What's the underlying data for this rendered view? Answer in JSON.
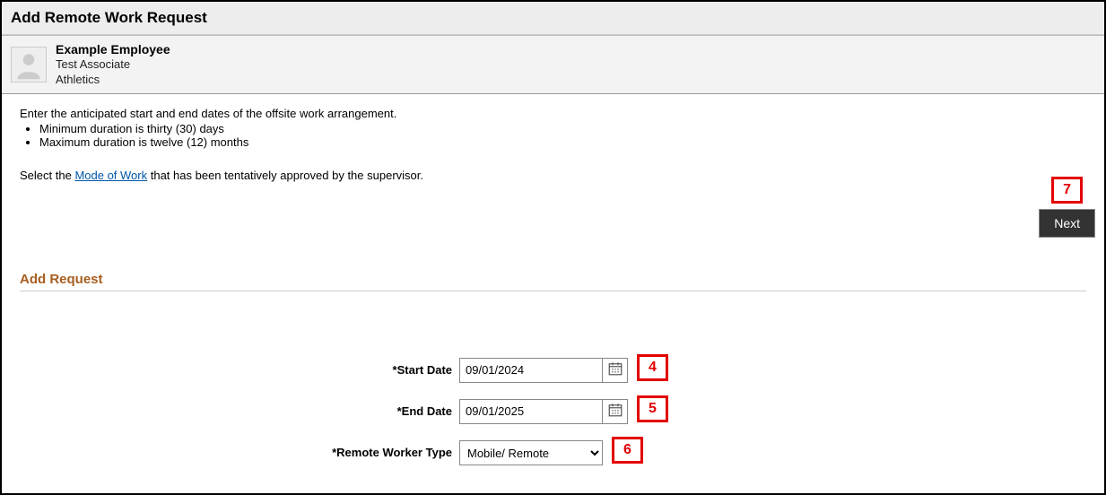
{
  "header": {
    "title": "Add Remote Work Request"
  },
  "employee": {
    "name": "Example Employee",
    "role": "Test Associate",
    "department": "Athletics"
  },
  "instructions": {
    "intro": "Enter the anticipated start and end dates of the offsite work arrangement.",
    "bullets": [
      "Minimum duration is thirty (30) days",
      "Maximum duration is twelve (12) months"
    ],
    "mode_prefix": "Select the ",
    "mode_link": "Mode of Work",
    "mode_suffix": " that has been tentatively approved by the supervisor."
  },
  "next_button": {
    "label": "Next",
    "callout": "7"
  },
  "section": {
    "title": "Add Request"
  },
  "form": {
    "start_date": {
      "label": "*Start Date",
      "value": "09/01/2024",
      "callout": "4"
    },
    "end_date": {
      "label": "*End Date",
      "value": "09/01/2025",
      "callout": "5"
    },
    "worker_type": {
      "label": "*Remote Worker Type",
      "selected": "Mobile/ Remote",
      "callout": "6"
    }
  }
}
